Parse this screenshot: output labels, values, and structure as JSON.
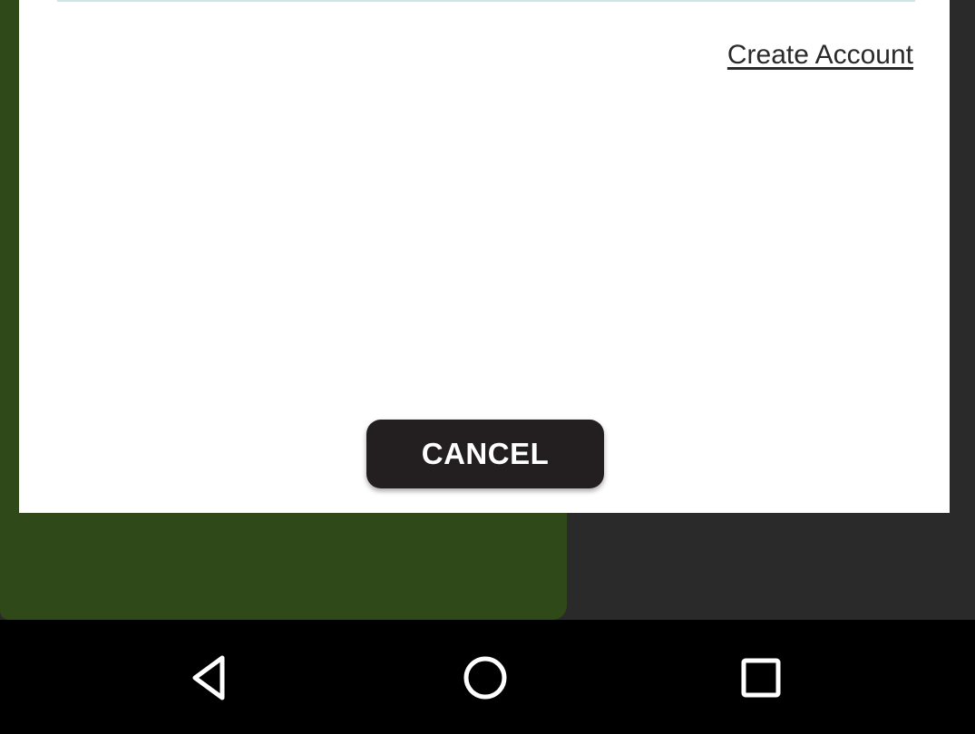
{
  "dialog": {
    "create_account_link": "Create Account",
    "cancel_label": "CANCEL"
  },
  "colors": {
    "backdrop_green": "#2f4a18",
    "backdrop_dark": "#2a2a2a",
    "dialog_bg": "#ffffff",
    "cancel_button_bg": "#231f20",
    "nav_bar_bg": "#000000",
    "nav_icon": "#ffffff"
  },
  "navigation_bar": {
    "icons": [
      "back-icon",
      "home-icon",
      "recents-icon"
    ]
  }
}
